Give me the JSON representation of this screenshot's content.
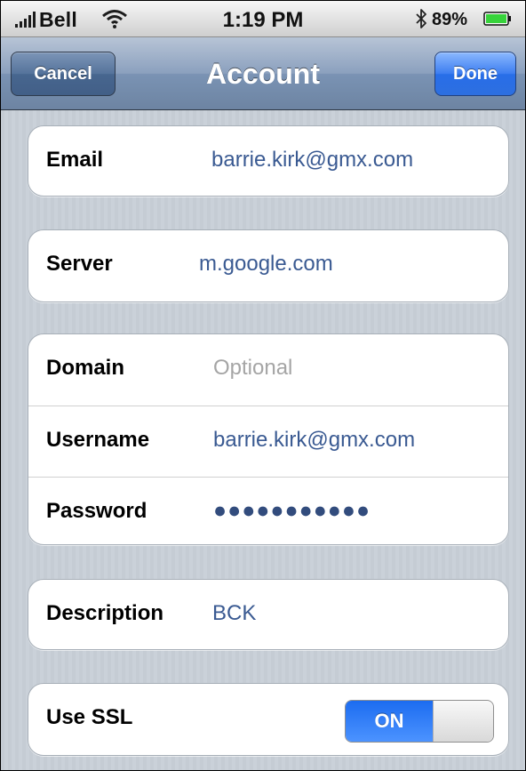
{
  "status_bar": {
    "carrier": "Bell",
    "time": "1:19 PM",
    "battery_percent": "89%",
    "icons": [
      "signal-strength-icon",
      "wifi-icon",
      "bluetooth-icon",
      "battery-icon"
    ]
  },
  "nav": {
    "title": "Account",
    "cancel_label": "Cancel",
    "done_label": "Done"
  },
  "fields": {
    "email": {
      "label": "Email",
      "value": "barrie.kirk@gmx.com"
    },
    "server": {
      "label": "Server",
      "value": "m.google.com"
    },
    "domain": {
      "label": "Domain",
      "placeholder": "Optional"
    },
    "username": {
      "label": "Username",
      "value": "barrie.kirk@gmx.com"
    },
    "password": {
      "label": "Password",
      "value": "●●●●●●●●●●●"
    },
    "description": {
      "label": "Description",
      "value": "BCK"
    },
    "ssl": {
      "label": "Use SSL",
      "value": "ON"
    }
  },
  "colors": {
    "value_text": "#3a5a92",
    "accent_blue": "#286ee8",
    "nav_bar": "#6d84a2",
    "page_background": "#c5ccd4"
  }
}
